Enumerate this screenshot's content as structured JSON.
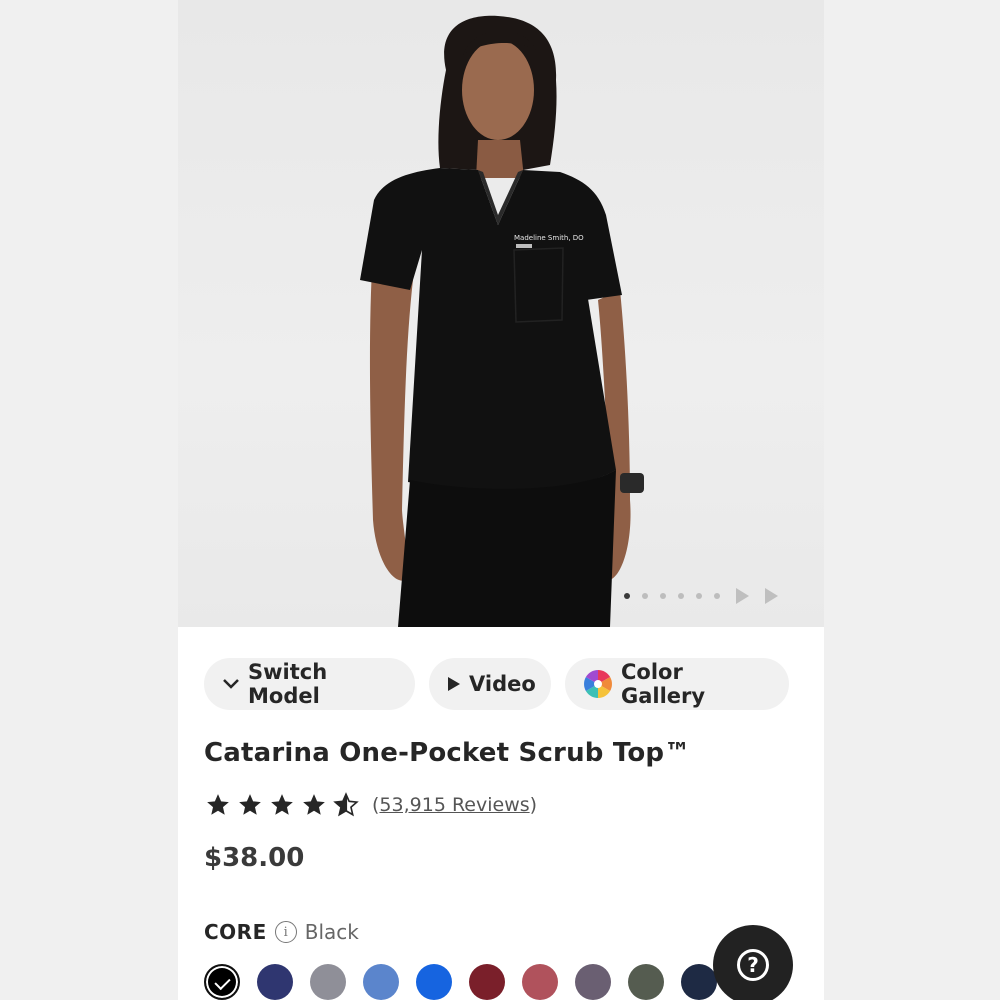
{
  "product": {
    "title": "Catarina One-Pocket Scrub Top™",
    "rating": 4.5,
    "reviews_open": "(",
    "reviews_count": "53,915 Reviews",
    "reviews_close": ")",
    "price": "$38.00"
  },
  "hero": {
    "embroidery_text": "Madeline Smith, DO",
    "carousel": {
      "dot_count": 6,
      "active_index": 0
    }
  },
  "buttons": {
    "switch_model": "Switch Model",
    "video": "Video",
    "color_gallery": "Color Gallery"
  },
  "color_selector": {
    "collection": "CORE",
    "info_glyph": "i",
    "selected_color": "Black",
    "swatches": [
      "#000000",
      "#2f3670",
      "#8f8f98",
      "#5b85cc",
      "#1664e0",
      "#7a1f2a",
      "#b0525c",
      "#6a5f72",
      "#555c50",
      "#1e2a44"
    ],
    "selected_index": 0
  },
  "help": {
    "glyph": "?"
  },
  "colors": {
    "text": "#262626",
    "pill_bg": "#f1f1f1",
    "help_bg": "#222222"
  }
}
